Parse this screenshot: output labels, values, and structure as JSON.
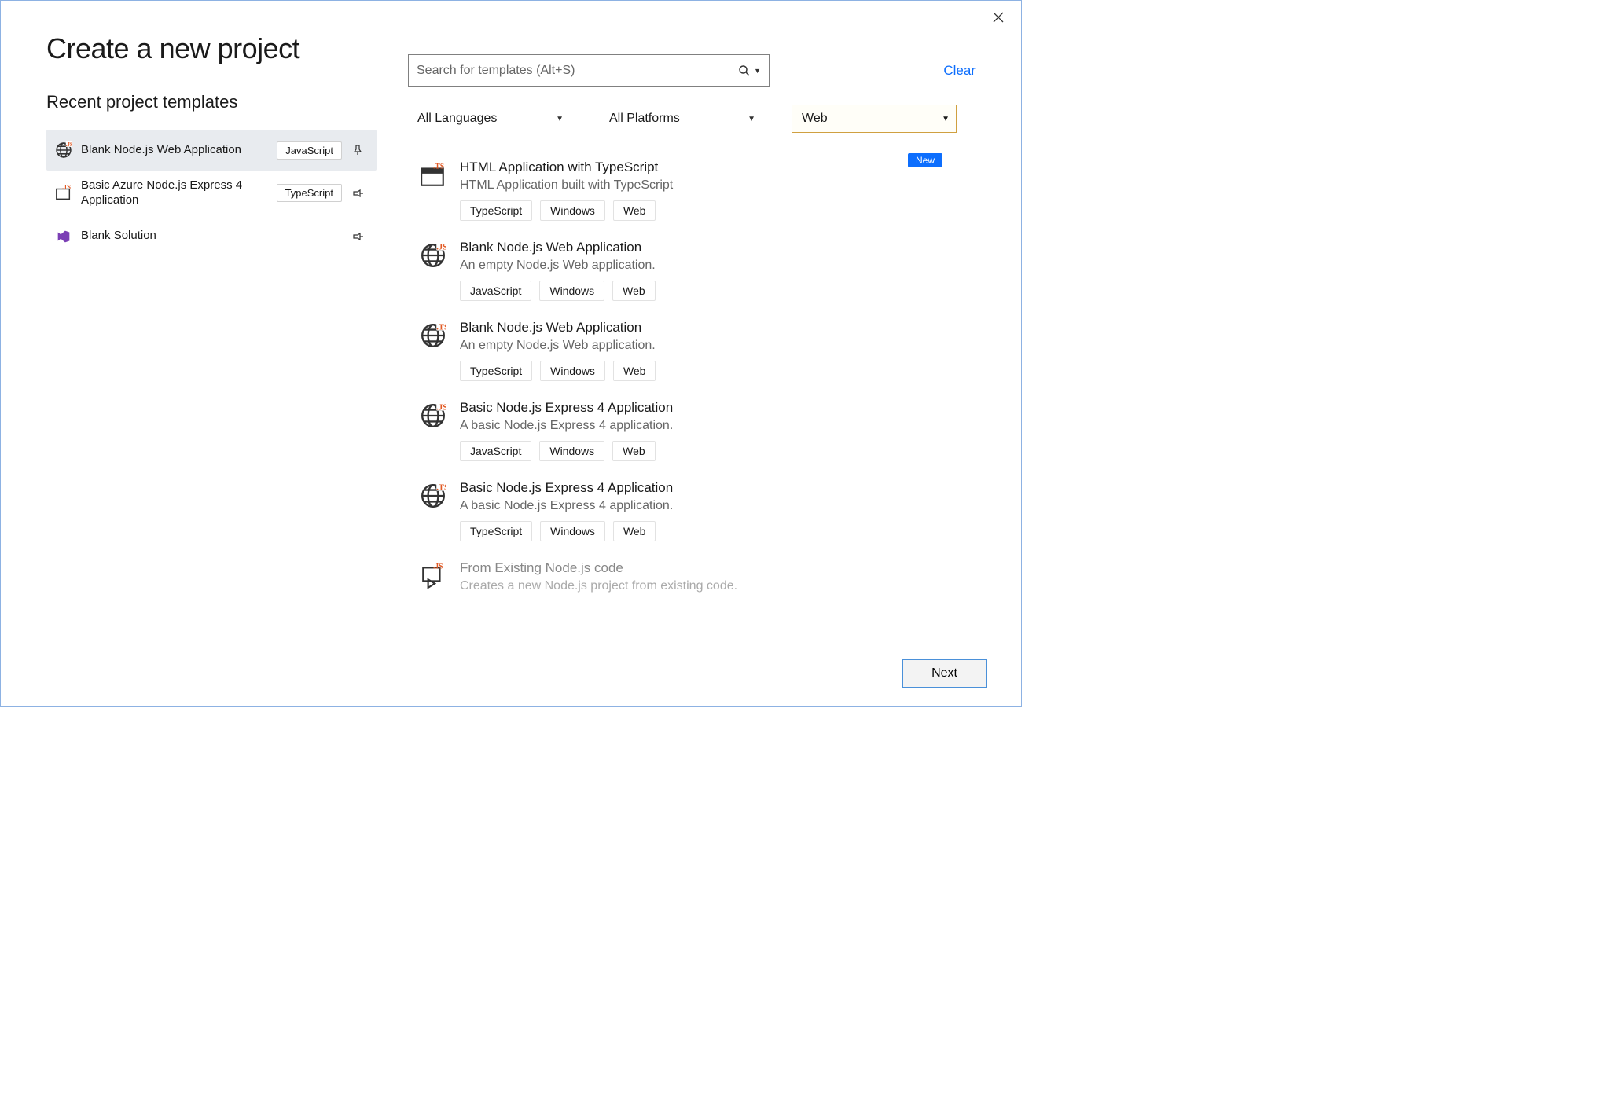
{
  "page_title": "Create a new project",
  "recent_heading": "Recent project templates",
  "search": {
    "placeholder": "Search for templates (Alt+S)"
  },
  "clear_label": "Clear",
  "filters": {
    "language": "All Languages",
    "platform": "All Platforms",
    "type": "Web"
  },
  "recent": [
    {
      "label": "Blank Node.js Web Application",
      "lang": "JavaScript",
      "icon": "globe-js",
      "selected": true,
      "pin": "unpinned"
    },
    {
      "label": "Basic Azure Node.js Express 4 Application",
      "lang": "TypeScript",
      "icon": "ts-small",
      "selected": false,
      "pin": "pin"
    },
    {
      "label": "Blank Solution",
      "lang": "",
      "icon": "vs",
      "selected": false,
      "pin": "pin"
    }
  ],
  "new_badge": "New",
  "templates": [
    {
      "title": "HTML Application with TypeScript",
      "desc": "HTML Application built with TypeScript",
      "tags": [
        "TypeScript",
        "Windows",
        "Web"
      ],
      "icon": "window-ts",
      "badge": true
    },
    {
      "title": "Blank Node.js Web Application",
      "desc": "An empty Node.js Web application.",
      "tags": [
        "JavaScript",
        "Windows",
        "Web"
      ],
      "icon": "globe-js"
    },
    {
      "title": "Blank Node.js Web Application",
      "desc": "An empty Node.js Web application.",
      "tags": [
        "TypeScript",
        "Windows",
        "Web"
      ],
      "icon": "globe-ts"
    },
    {
      "title": "Basic Node.js Express 4 Application",
      "desc": "A basic Node.js Express 4 application.",
      "tags": [
        "JavaScript",
        "Windows",
        "Web"
      ],
      "icon": "globe-js"
    },
    {
      "title": "Basic Node.js Express 4 Application",
      "desc": "A basic Node.js Express 4 application.",
      "tags": [
        "TypeScript",
        "Windows",
        "Web"
      ],
      "icon": "globe-ts"
    },
    {
      "title": "From Existing Node.js code",
      "desc": "Creates a new Node.js project from existing code.",
      "tags": [],
      "icon": "node-existing",
      "faded": true
    }
  ],
  "next_label": "Next"
}
